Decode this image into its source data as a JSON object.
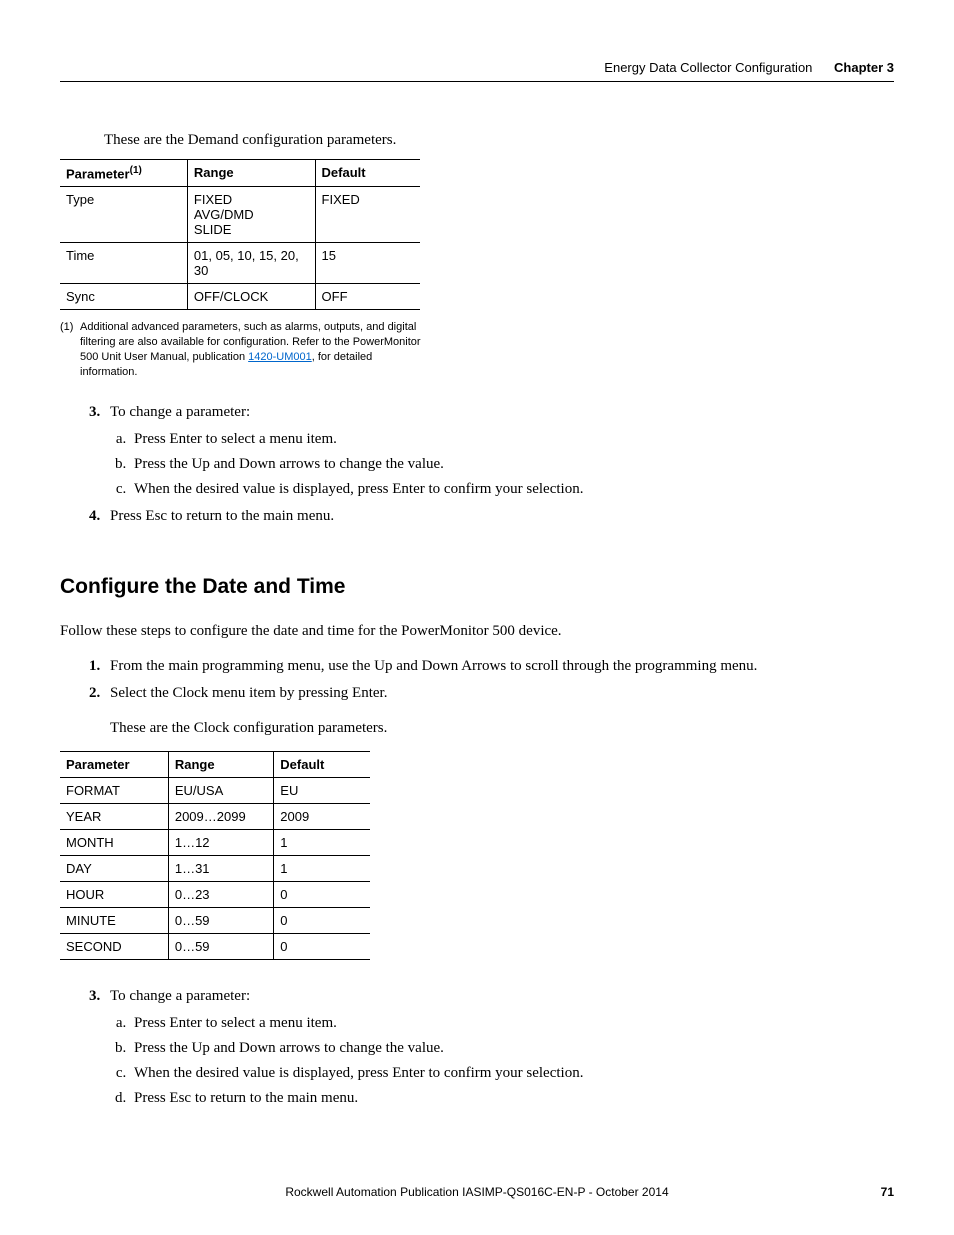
{
  "header": {
    "section_title": "Energy Data Collector Configuration",
    "chapter_label": "Chapter 3"
  },
  "intro1": "These are the Demand configuration parameters.",
  "table1": {
    "headers": {
      "param": "Parameter",
      "param_sup": "(1)",
      "range": "Range",
      "default": "Default"
    },
    "rows": [
      {
        "p": "Type",
        "r": "FIXED\nAVG/DMD\nSLIDE",
        "d": "FIXED"
      },
      {
        "p": "Time",
        "r": "01, 05, 10, 15, 20, 30",
        "d": "15"
      },
      {
        "p": "Sync",
        "r": "OFF/CLOCK",
        "d": "OFF"
      }
    ]
  },
  "footnote": {
    "num": "(1)",
    "text_a": "Additional advanced parameters, such as alarms, outputs, and digital filtering are also available for configuration. Refer to the PowerMonitor 500 Unit User Manual, publication ",
    "link": "1420-UM001",
    "text_b": ", for detailed information."
  },
  "steps1": {
    "s3": "To change a parameter:",
    "s3a": "Press Enter to select a menu item.",
    "s3b": "Press the Up and Down arrows to change the value.",
    "s3c": "When the desired value is displayed, press Enter to confirm your selection.",
    "s4": "Press Esc to return to the main menu."
  },
  "heading2": "Configure the Date and Time",
  "para2": "Follow these steps to configure the date and time for the PowerMonitor 500 device.",
  "steps2": {
    "s1": "From the main programming menu, use the Up and Down Arrows to scroll through the programming menu.",
    "s2": "Select the Clock menu item by pressing Enter.",
    "s2_after": "These are the Clock configuration parameters."
  },
  "table2": {
    "headers": {
      "param": "Parameter",
      "range": "Range",
      "default": "Default"
    },
    "rows": [
      {
        "p": "FORMAT",
        "r": "EU/USA",
        "d": "EU"
      },
      {
        "p": "YEAR",
        "r": "2009…2099",
        "d": "2009"
      },
      {
        "p": "MONTH",
        "r": "1…12",
        "d": "1"
      },
      {
        "p": "DAY",
        "r": "1…31",
        "d": "1"
      },
      {
        "p": "HOUR",
        "r": "0…23",
        "d": "0"
      },
      {
        "p": "MINUTE",
        "r": "0…59",
        "d": "0"
      },
      {
        "p": "SECOND",
        "r": "0…59",
        "d": "0"
      }
    ]
  },
  "steps3": {
    "s3": "To change a parameter:",
    "s3a": "Press Enter to select a menu item.",
    "s3b": "Press the Up and Down arrows to change the value.",
    "s3c": "When the desired value is displayed, press Enter to confirm your selection.",
    "s3d": "Press Esc to return to the main menu."
  },
  "footer": {
    "pub": "Rockwell Automation Publication IASIMP-QS016C-EN-P - October 2014",
    "page": "71"
  }
}
